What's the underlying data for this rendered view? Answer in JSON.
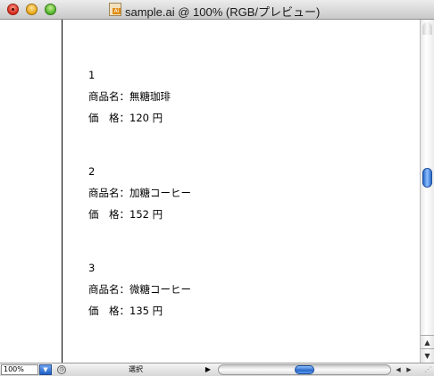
{
  "window": {
    "title": "sample.ai @ 100% (RGB/プレビュー)",
    "file_icon": "ai-file-icon",
    "file_icon_text": "Ai"
  },
  "document": {
    "items": [
      {
        "number": "1",
        "name_line": "商品名：無糖珈琲",
        "price_line": "価　格：120 円"
      },
      {
        "number": "2",
        "name_line": "商品名：加糖コーヒー",
        "price_line": "価　格：152 円"
      },
      {
        "number": "3",
        "name_line": "商品名：微糖コーヒー",
        "price_line": "価　格：135 円"
      }
    ]
  },
  "statusbar": {
    "zoom": "100%",
    "tool": "選択"
  },
  "colors": {
    "scroll_thumb": "#2a69c9",
    "close": "#d6281b",
    "minimize": "#e6a614",
    "zoom": "#4fb12a"
  }
}
